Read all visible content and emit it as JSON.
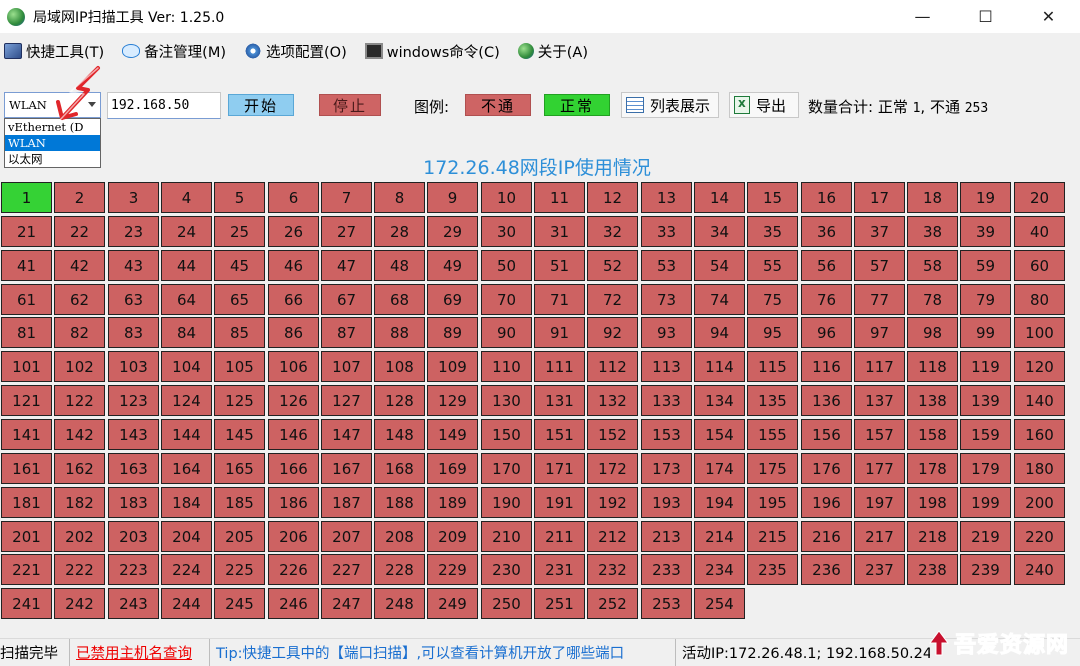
{
  "window": {
    "title": "局域网IP扫描工具  Ver: 1.25.0",
    "minimize": "—",
    "maximize": "☐",
    "close": "✕"
  },
  "menu": {
    "items": [
      {
        "label": "快捷工具(T)",
        "icon": "tools-icon"
      },
      {
        "label": "备注管理(M)",
        "icon": "chat-bubble-icon"
      },
      {
        "label": "选项配置(O)",
        "icon": "settings-icon"
      },
      {
        "label": "windows命令(C)",
        "icon": "terminal-icon"
      },
      {
        "label": "关于(A)",
        "icon": "globe-icon"
      }
    ]
  },
  "toolbar": {
    "adapter_selected": "WLAN",
    "adapter_options": [
      "vEthernet (D",
      "WLAN",
      "以太网"
    ],
    "ip_value": "192.168.50",
    "start_label": "开始",
    "stop_label": "停止",
    "legend_label": "图例:",
    "legend_fail": "不通",
    "legend_ok": "正常",
    "list_view_label": "列表展示",
    "export_label": "导出",
    "count_prefix": "数量合计: 正常 ",
    "count_ok": "1",
    "count_sep": ", 不通 ",
    "count_fail": "253",
    "start_color": "#8fcdf0",
    "fail_color": "#ce6464",
    "ok_color": "#32d232"
  },
  "grid": {
    "title": "172.26.48网段IP使用情况",
    "total": 254,
    "ok_hosts": [
      1
    ]
  },
  "status": {
    "state": "扫描完毕",
    "hostname_link": "已禁用主机名查询",
    "tip": "Tip:快捷工具中的【端口扫描】,可以查看计算机开放了哪些端口",
    "active_ip": "活动IP:172.26.48.1; 192.168.50.24"
  },
  "watermark": {
    "text": "吾爱资源网"
  }
}
